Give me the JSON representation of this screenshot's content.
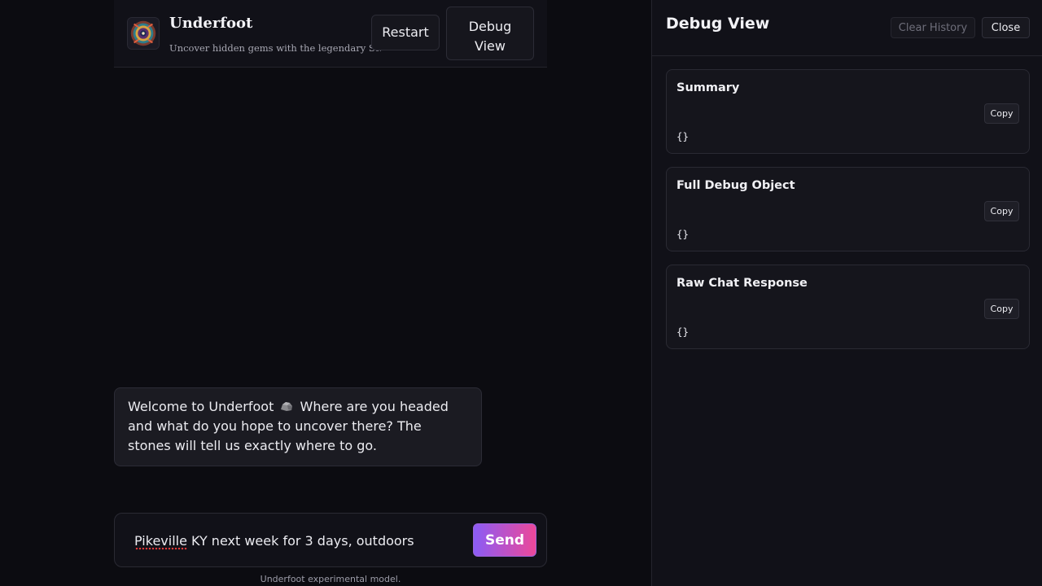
{
  "header": {
    "title": "Underfoot",
    "subtitle": "Uncover hidden gems with the legendary Stonewalker",
    "restart_label": "Restart",
    "debug_label_line1": "Debug",
    "debug_label_line2": "View"
  },
  "messages": [
    {
      "role": "assistant",
      "text_before_icon": "Welcome to Underfoot",
      "icon": "rock-icon",
      "text_after_icon": "Where are you headed and what do you hope to uncover there? The stones will tell us exactly where to go."
    }
  ],
  "composer": {
    "value": "Pikeville KY next week for 3 days, outdoors",
    "send_label": "Send"
  },
  "footer_note": "Underfoot experimental model.",
  "debug": {
    "title": "Debug View",
    "clear_label": "Clear History",
    "close_label": "Close",
    "cards": [
      {
        "title": "Summary",
        "copy_label": "Copy",
        "content": "{}"
      },
      {
        "title": "Full Debug Object",
        "copy_label": "Copy",
        "content": "{}"
      },
      {
        "title": "Raw Chat Response",
        "copy_label": "Copy",
        "content": "{}"
      }
    ]
  },
  "colors": {
    "background": "#0c0c11",
    "panel": "#111118",
    "send_gradient_start": "#8b5cf6",
    "send_gradient_end": "#ec4899"
  }
}
